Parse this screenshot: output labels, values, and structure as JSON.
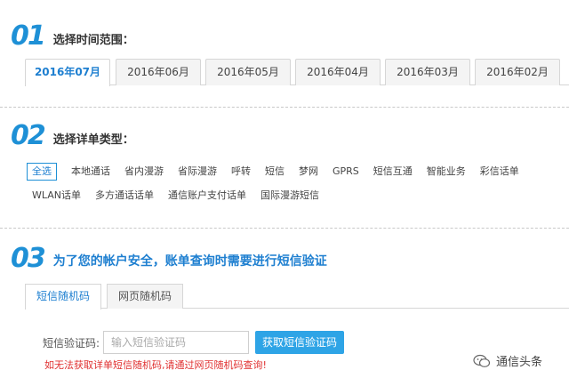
{
  "step1": {
    "number": "01",
    "title": "选择时间范围："
  },
  "months": [
    {
      "label": "2016年07月",
      "active": true
    },
    {
      "label": "2016年06月",
      "active": false
    },
    {
      "label": "2016年05月",
      "active": false
    },
    {
      "label": "2016年04月",
      "active": false
    },
    {
      "label": "2016年03月",
      "active": false
    },
    {
      "label": "2016年02月",
      "active": false
    }
  ],
  "step2": {
    "number": "02",
    "title": "选择详单类型："
  },
  "types_row1": [
    "全选",
    "本地通话",
    "省内漫游",
    "省际漫游",
    "呼转",
    "短信",
    "梦网",
    "GPRS",
    "短信互通",
    "智能业务",
    "彩信话单"
  ],
  "types_row2": [
    "WLAN话单",
    "多方通话话单",
    "通信账户支付话单",
    "国际漫游短信"
  ],
  "step3": {
    "number": "03",
    "title": "为了您的帐户安全，账单查询时需要进行短信验证"
  },
  "verify_tabs": [
    {
      "label": "短信随机码",
      "active": true
    },
    {
      "label": "网页随机码",
      "active": false
    }
  ],
  "form": {
    "label": "短信验证码:",
    "placeholder": "输入短信验证码",
    "button": "获取短信验证码",
    "warning": "如无法获取详单短信随机码,请通过网页随机码查询!"
  },
  "watermark": {
    "text": "通信头条",
    "icon": "wechat-icon"
  },
  "colors": {
    "accent": "#1e90d6",
    "button": "#2ea4e6",
    "warning": "#e03030"
  }
}
